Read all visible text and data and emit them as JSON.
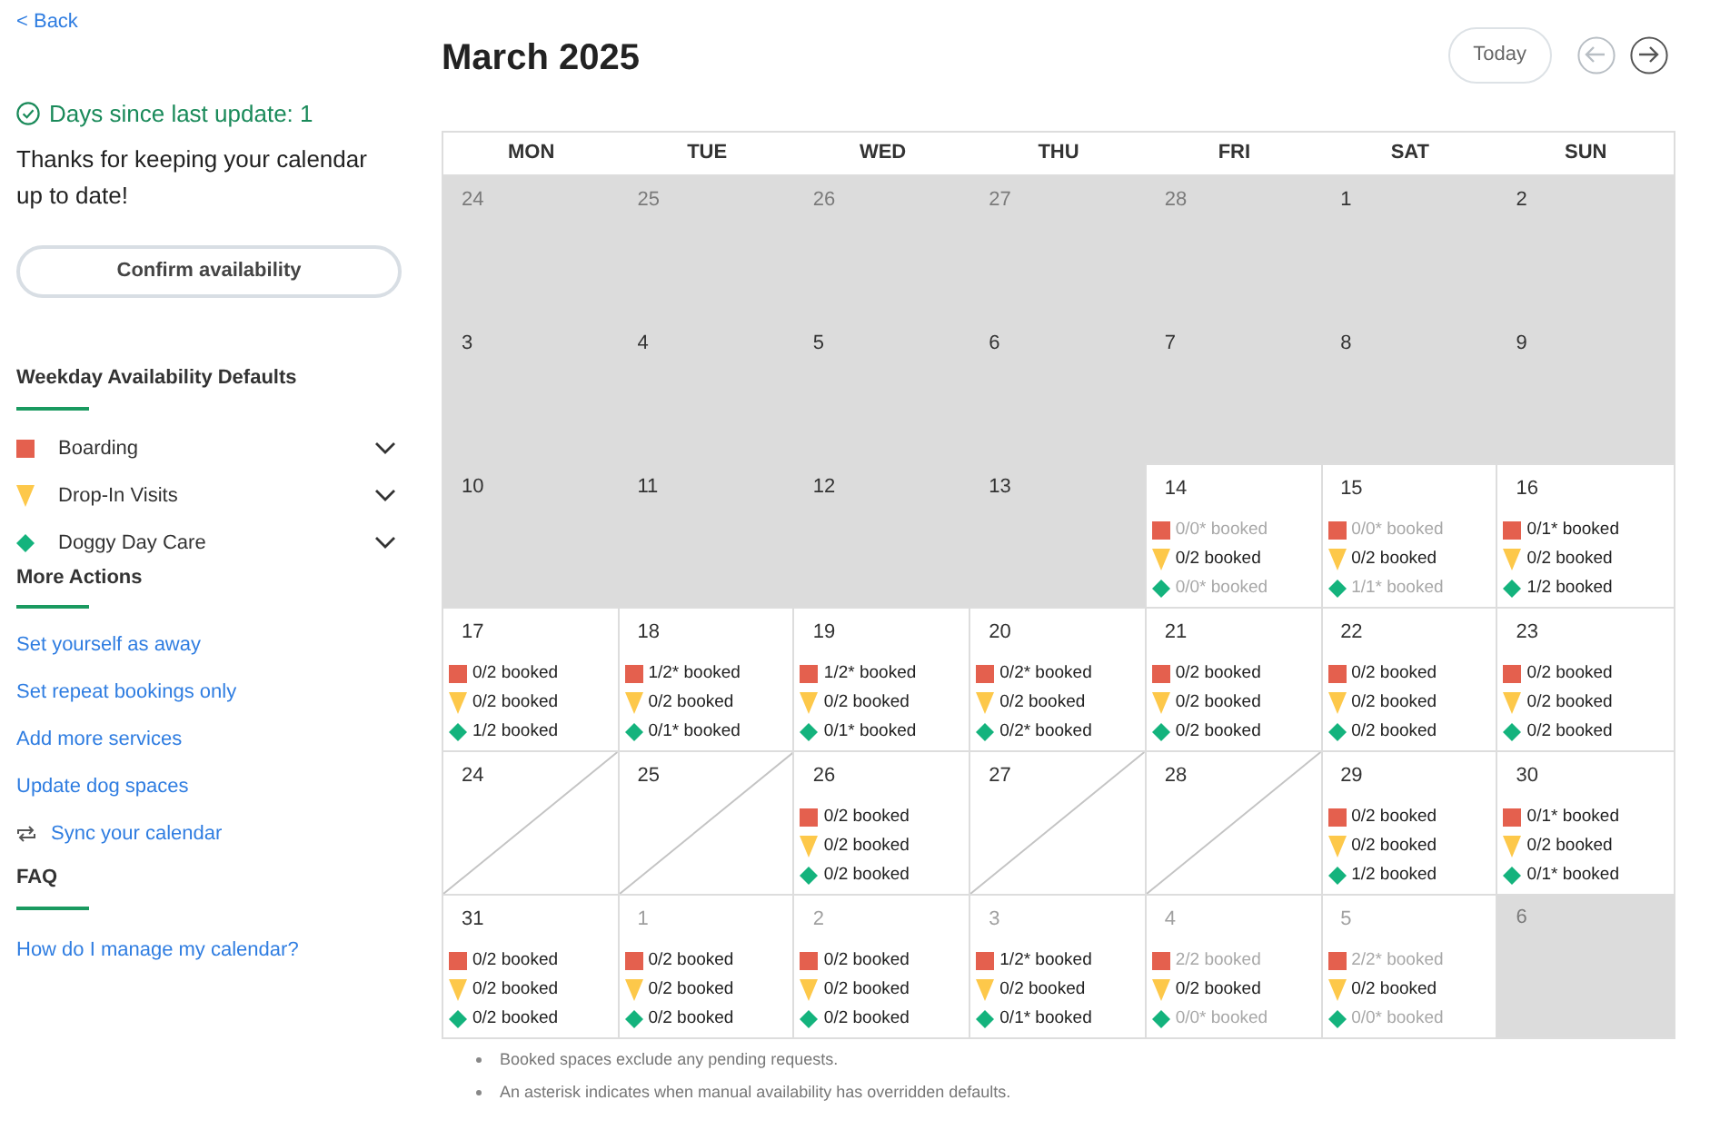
{
  "back_link": "< Back",
  "status": {
    "text": "Days since last update: 1",
    "message": "Thanks for keeping your calendar up to date!"
  },
  "confirm_button": "Confirm availability",
  "defaults": {
    "heading": "Weekday Availability Defaults",
    "services": [
      {
        "kind": "boarding",
        "label": "Boarding"
      },
      {
        "kind": "dropin",
        "label": "Drop-In Visits"
      },
      {
        "kind": "daycare",
        "label": "Doggy Day Care"
      }
    ]
  },
  "more_actions": {
    "heading": "More Actions",
    "links": [
      {
        "kind": "plain",
        "label": "Set yourself as away"
      },
      {
        "kind": "plain",
        "label": "Set repeat bookings only"
      },
      {
        "kind": "plain",
        "label": "Add more services"
      },
      {
        "kind": "plain",
        "label": "Update dog spaces"
      },
      {
        "kind": "sync",
        "label": "Sync your calendar"
      }
    ]
  },
  "faq": {
    "heading": "FAQ",
    "links": [
      "How do I manage my calendar?"
    ]
  },
  "calendar": {
    "title": "March 2025",
    "today_button": "Today",
    "prev": {
      "disabled": true
    },
    "next": {
      "disabled": false
    },
    "weekdays": [
      "MON",
      "TUE",
      "WED",
      "THU",
      "FRI",
      "SAT",
      "SUN"
    ],
    "days": [
      {
        "day": "24",
        "outside_month": true,
        "past": true,
        "unavailable": false
      },
      {
        "day": "25",
        "outside_month": true,
        "past": true,
        "unavailable": false
      },
      {
        "day": "26",
        "outside_month": true,
        "past": true,
        "unavailable": false
      },
      {
        "day": "27",
        "outside_month": true,
        "past": true,
        "unavailable": false
      },
      {
        "day": "28",
        "outside_month": true,
        "past": true,
        "unavailable": false
      },
      {
        "day": "1",
        "outside_month": false,
        "past": true,
        "unavailable": false
      },
      {
        "day": "2",
        "outside_month": false,
        "past": true,
        "unavailable": false
      },
      {
        "day": "3",
        "outside_month": false,
        "past": true,
        "unavailable": false
      },
      {
        "day": "4",
        "outside_month": false,
        "past": true,
        "unavailable": false
      },
      {
        "day": "5",
        "outside_month": false,
        "past": true,
        "unavailable": false
      },
      {
        "day": "6",
        "outside_month": false,
        "past": true,
        "unavailable": false
      },
      {
        "day": "7",
        "outside_month": false,
        "past": true,
        "unavailable": false
      },
      {
        "day": "8",
        "outside_month": false,
        "past": true,
        "unavailable": false
      },
      {
        "day": "9",
        "outside_month": false,
        "past": true,
        "unavailable": false
      },
      {
        "day": "10",
        "outside_month": false,
        "past": true,
        "unavailable": false
      },
      {
        "day": "11",
        "outside_month": false,
        "past": true,
        "unavailable": false
      },
      {
        "day": "12",
        "outside_month": false,
        "past": true,
        "unavailable": false
      },
      {
        "day": "13",
        "outside_month": false,
        "past": true,
        "unavailable": false
      },
      {
        "day": "14",
        "outside_month": false,
        "past": false,
        "unavailable": false,
        "services": [
          {
            "kind": "boarding",
            "text": "0/0* booked",
            "dimmed": true
          },
          {
            "kind": "dropin",
            "text": "0/2 booked",
            "dimmed": false
          },
          {
            "kind": "daycare",
            "text": "0/0* booked",
            "dimmed": true
          }
        ]
      },
      {
        "day": "15",
        "outside_month": false,
        "past": false,
        "unavailable": false,
        "services": [
          {
            "kind": "boarding",
            "text": "0/0* booked",
            "dimmed": true
          },
          {
            "kind": "dropin",
            "text": "0/2 booked",
            "dimmed": false
          },
          {
            "kind": "daycare",
            "text": "1/1* booked",
            "dimmed": true
          }
        ]
      },
      {
        "day": "16",
        "outside_month": false,
        "past": false,
        "unavailable": false,
        "services": [
          {
            "kind": "boarding",
            "text": "0/1* booked",
            "dimmed": false
          },
          {
            "kind": "dropin",
            "text": "0/2 booked",
            "dimmed": false
          },
          {
            "kind": "daycare",
            "text": "1/2 booked",
            "dimmed": false
          }
        ]
      },
      {
        "day": "17",
        "outside_month": false,
        "past": false,
        "unavailable": false,
        "services": [
          {
            "kind": "boarding",
            "text": "0/2 booked",
            "dimmed": false
          },
          {
            "kind": "dropin",
            "text": "0/2 booked",
            "dimmed": false
          },
          {
            "kind": "daycare",
            "text": "1/2 booked",
            "dimmed": false
          }
        ]
      },
      {
        "day": "18",
        "outside_month": false,
        "past": false,
        "unavailable": false,
        "services": [
          {
            "kind": "boarding",
            "text": "1/2* booked",
            "dimmed": false
          },
          {
            "kind": "dropin",
            "text": "0/2 booked",
            "dimmed": false
          },
          {
            "kind": "daycare",
            "text": "0/1* booked",
            "dimmed": false
          }
        ]
      },
      {
        "day": "19",
        "outside_month": false,
        "past": false,
        "unavailable": false,
        "services": [
          {
            "kind": "boarding",
            "text": "1/2* booked",
            "dimmed": false
          },
          {
            "kind": "dropin",
            "text": "0/2 booked",
            "dimmed": false
          },
          {
            "kind": "daycare",
            "text": "0/1* booked",
            "dimmed": false
          }
        ]
      },
      {
        "day": "20",
        "outside_month": false,
        "past": false,
        "unavailable": false,
        "services": [
          {
            "kind": "boarding",
            "text": "0/2* booked",
            "dimmed": false
          },
          {
            "kind": "dropin",
            "text": "0/2 booked",
            "dimmed": false
          },
          {
            "kind": "daycare",
            "text": "0/2* booked",
            "dimmed": false
          }
        ]
      },
      {
        "day": "21",
        "outside_month": false,
        "past": false,
        "unavailable": false,
        "services": [
          {
            "kind": "boarding",
            "text": "0/2 booked",
            "dimmed": false
          },
          {
            "kind": "dropin",
            "text": "0/2 booked",
            "dimmed": false
          },
          {
            "kind": "daycare",
            "text": "0/2 booked",
            "dimmed": false
          }
        ]
      },
      {
        "day": "22",
        "outside_month": false,
        "past": false,
        "unavailable": false,
        "services": [
          {
            "kind": "boarding",
            "text": "0/2 booked",
            "dimmed": false
          },
          {
            "kind": "dropin",
            "text": "0/2 booked",
            "dimmed": false
          },
          {
            "kind": "daycare",
            "text": "0/2 booked",
            "dimmed": false
          }
        ]
      },
      {
        "day": "23",
        "outside_month": false,
        "past": false,
        "unavailable": false,
        "services": [
          {
            "kind": "boarding",
            "text": "0/2 booked",
            "dimmed": false
          },
          {
            "kind": "dropin",
            "text": "0/2 booked",
            "dimmed": false
          },
          {
            "kind": "daycare",
            "text": "0/2 booked",
            "dimmed": false
          }
        ]
      },
      {
        "day": "24",
        "outside_month": false,
        "past": false,
        "unavailable": true
      },
      {
        "day": "25",
        "outside_month": false,
        "past": false,
        "unavailable": true
      },
      {
        "day": "26",
        "outside_month": false,
        "past": false,
        "unavailable": false,
        "services": [
          {
            "kind": "boarding",
            "text": "0/2 booked",
            "dimmed": false
          },
          {
            "kind": "dropin",
            "text": "0/2 booked",
            "dimmed": false
          },
          {
            "kind": "daycare",
            "text": "0/2 booked",
            "dimmed": false
          }
        ]
      },
      {
        "day": "27",
        "outside_month": false,
        "past": false,
        "unavailable": true
      },
      {
        "day": "28",
        "outside_month": false,
        "past": false,
        "unavailable": true
      },
      {
        "day": "29",
        "outside_month": false,
        "past": false,
        "unavailable": false,
        "services": [
          {
            "kind": "boarding",
            "text": "0/2 booked",
            "dimmed": false
          },
          {
            "kind": "dropin",
            "text": "0/2 booked",
            "dimmed": false
          },
          {
            "kind": "daycare",
            "text": "1/2 booked",
            "dimmed": false
          }
        ]
      },
      {
        "day": "30",
        "outside_month": false,
        "past": false,
        "unavailable": false,
        "services": [
          {
            "kind": "boarding",
            "text": "0/1* booked",
            "dimmed": false
          },
          {
            "kind": "dropin",
            "text": "0/2 booked",
            "dimmed": false
          },
          {
            "kind": "daycare",
            "text": "0/1* booked",
            "dimmed": false
          }
        ]
      },
      {
        "day": "31",
        "outside_month": false,
        "past": false,
        "unavailable": false,
        "services": [
          {
            "kind": "boarding",
            "text": "0/2 booked",
            "dimmed": false
          },
          {
            "kind": "dropin",
            "text": "0/2 booked",
            "dimmed": false
          },
          {
            "kind": "daycare",
            "text": "0/2 booked",
            "dimmed": false
          }
        ]
      },
      {
        "day": "1",
        "outside_month": true,
        "past": false,
        "unavailable": false,
        "services": [
          {
            "kind": "boarding",
            "text": "0/2 booked",
            "dimmed": false
          },
          {
            "kind": "dropin",
            "text": "0/2 booked",
            "dimmed": false
          },
          {
            "kind": "daycare",
            "text": "0/2 booked",
            "dimmed": false
          }
        ]
      },
      {
        "day": "2",
        "outside_month": true,
        "past": false,
        "unavailable": false,
        "services": [
          {
            "kind": "boarding",
            "text": "0/2 booked",
            "dimmed": false
          },
          {
            "kind": "dropin",
            "text": "0/2 booked",
            "dimmed": false
          },
          {
            "kind": "daycare",
            "text": "0/2 booked",
            "dimmed": false
          }
        ]
      },
      {
        "day": "3",
        "outside_month": true,
        "past": false,
        "unavailable": false,
        "services": [
          {
            "kind": "boarding",
            "text": "1/2* booked",
            "dimmed": false
          },
          {
            "kind": "dropin",
            "text": "0/2 booked",
            "dimmed": false
          },
          {
            "kind": "daycare",
            "text": "0/1* booked",
            "dimmed": false
          }
        ]
      },
      {
        "day": "4",
        "outside_month": true,
        "past": false,
        "unavailable": false,
        "services": [
          {
            "kind": "boarding",
            "text": "2/2 booked",
            "dimmed": true
          },
          {
            "kind": "dropin",
            "text": "0/2 booked",
            "dimmed": false
          },
          {
            "kind": "daycare",
            "text": "0/0* booked",
            "dimmed": true
          }
        ]
      },
      {
        "day": "5",
        "outside_month": true,
        "past": false,
        "unavailable": false,
        "services": [
          {
            "kind": "boarding",
            "text": "2/2* booked",
            "dimmed": true
          },
          {
            "kind": "dropin",
            "text": "0/2 booked",
            "dimmed": false
          },
          {
            "kind": "daycare",
            "text": "0/0* booked",
            "dimmed": true
          }
        ]
      },
      {
        "day": "6",
        "outside_month": true,
        "past": true,
        "unavailable": false
      }
    ],
    "notes": [
      "Booked spaces exclude any pending requests.",
      "An asterisk indicates when manual availability has overridden defaults."
    ]
  }
}
